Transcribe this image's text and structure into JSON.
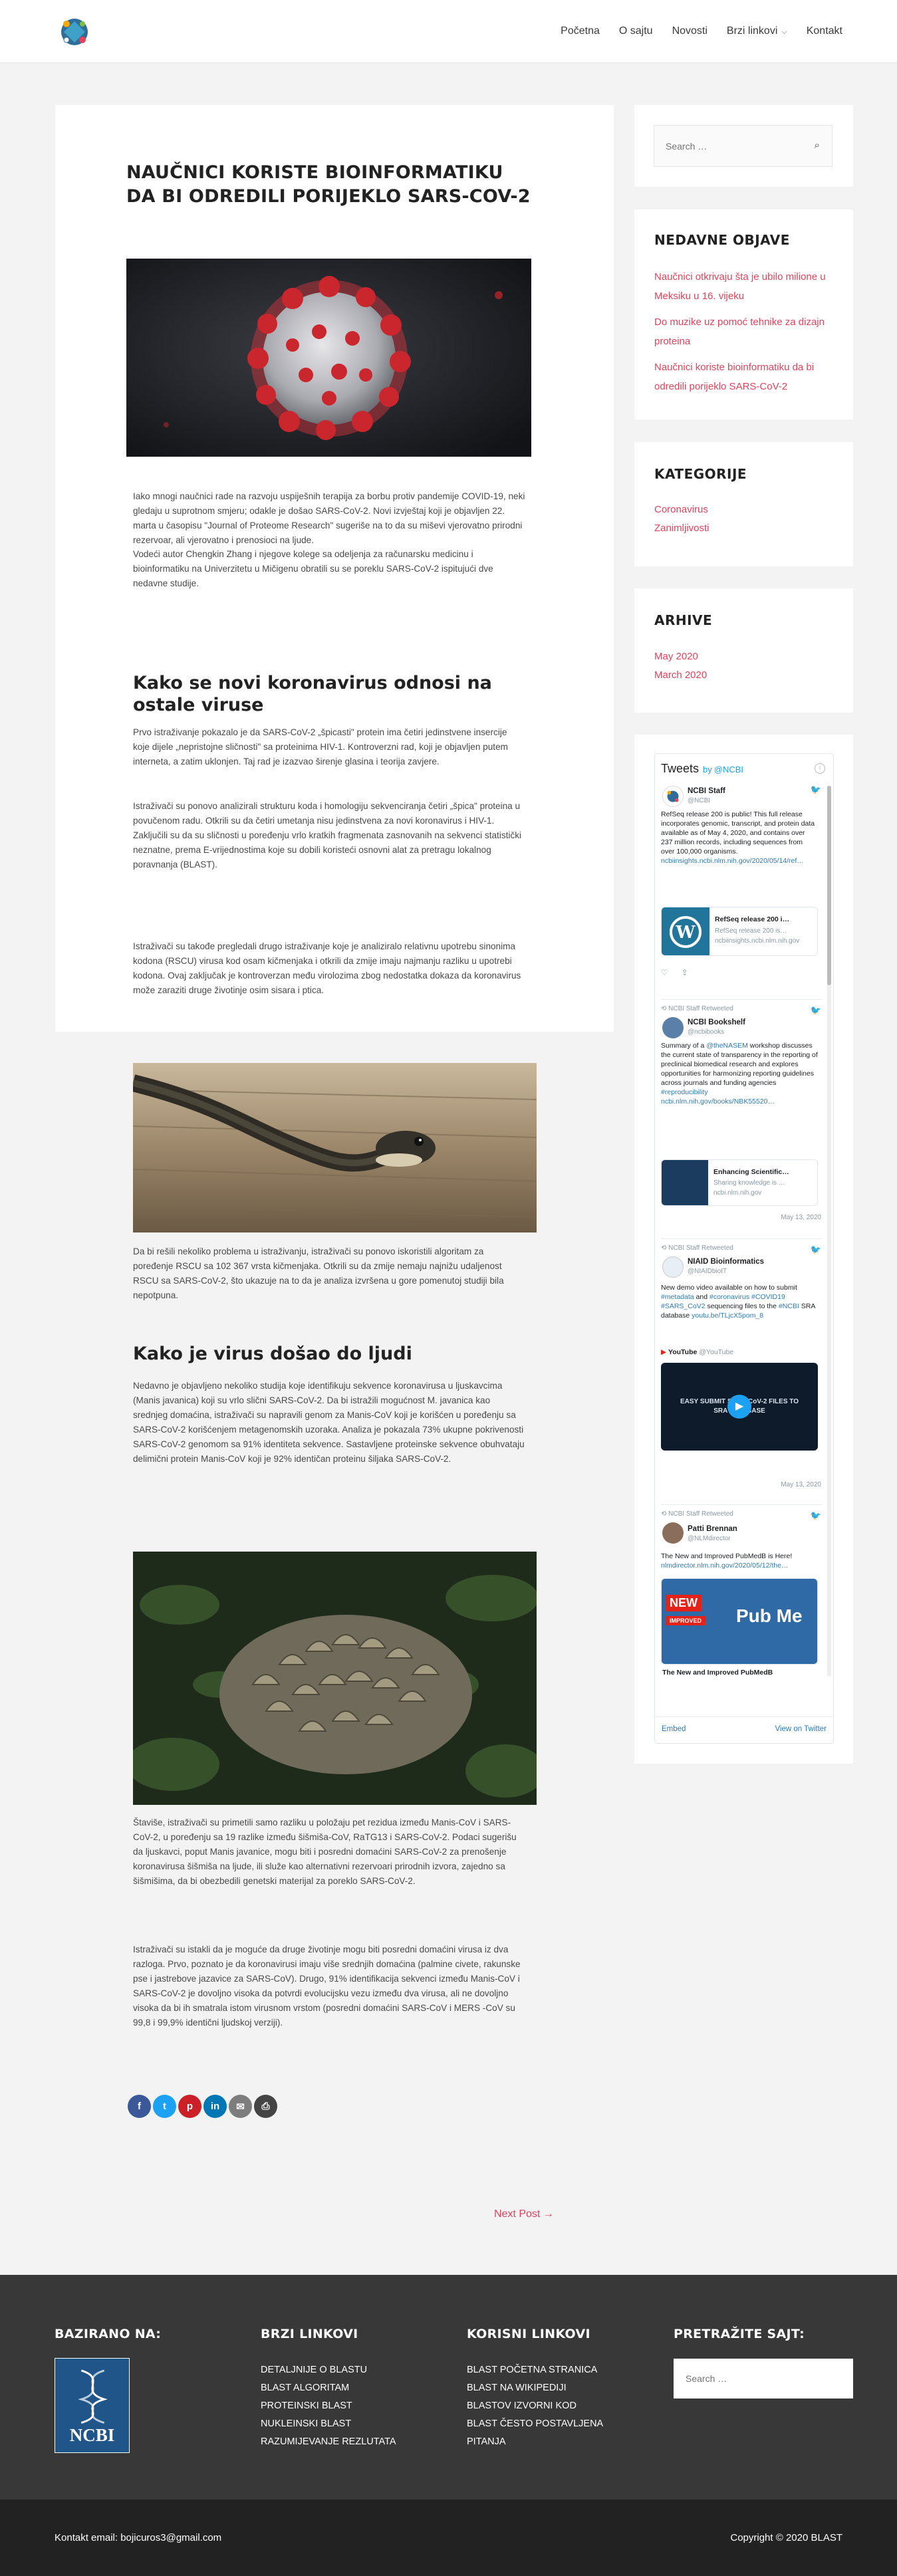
{
  "nav": {
    "items": [
      "Početna",
      "O sajtu",
      "Novosti",
      "Brzi linkovi",
      "Kontakt"
    ]
  },
  "article": {
    "title": "NAUČNICI KORISTE BIOINFORMATIKU DA BI ODREDILI PORIJEKLO SARS-COV-2",
    "p1": "Iako mnogi naučnici rade na razvoju uspiješnih terapija za borbu protiv pandemije COVID-19, neki gledaju u suprotnom smjeru; odakle je došao SARS-CoV-2. Novi izvještaj koji je objavljen 22. marta u časopisu \"Journal of Proteome Research\" sugeriše na to da su miševi vjerovatno prirodni rezervoar, ali vjerovatno i prenosioci na ljude.",
    "p2": "Vodeći autor Chengkin Zhang i njegove kolege sa odeljenja za računarsku medicinu i bioinformatiku na Univerzitetu u Mičigenu obratili su se poreklu SARS-CoV-2 ispitujući dve nedavne studije.",
    "h2a": "Kako se novi koronavirus odnosi na ostale viruse",
    "p3": "Prvo istraživanje pokazalo je da SARS-CoV-2 „špicasti\" protein ima četiri jedinstvene insercije koje dijele „nepristojne sličnosti\" sa proteinima HIV-1. Kontroverzni rad, koji je objavljen putem interneta, a zatim uklonjen. Taj rad je izazvao širenje glasina i teorija zavjere.",
    "p4": "Istraživači su ponovo analizirali strukturu koda i homologiju sekvenciranja četiri „špica\" proteina u povučenom radu. Otkrili su da četiri umetanja nisu jedinstvena za novi koronavirus i HIV-1. Zaključili su da su sličnosti u poređenju vrlo kratkih fragmenata zasnovanih na sekvenci statistički neznatne, prema E-vrijednostima koje su dobili koristeći osnovni alat za pretragu lokalnog poravnanja (BLAST).",
    "p5": "Istraživači su takođe pregledali drugo istraživanje koje je analiziralo relativnu upotrebu sinonima kodona (RSCU) virusa kod osam kičmenjaka i otkrili da zmije imaju najmanju razliku u upotrebi kodona. Ovaj zaključak je kontroverzan među virolozima zbog nedostatka dokaza da koronavirus može zaraziti druge životinje osim sisara i ptica.",
    "p6": "Da bi rešili nekoliko problema u istraživanju, istraživači su ponovo iskoristili algoritam za poređenje RSCU sa 102 367 vrsta kičmenjaka. Otkrili su da zmije nemaju najnižu udaljenost RSCU sa SARS-CoV-2, što ukazuje na to da je analiza izvršena u gore pomenutoj studiji bila nepotpuna.",
    "h2b": "Kako je virus došao do ljudi",
    "p7": "Nedavno je objavljeno nekoliko studija koje identifikuju sekvence koronavirusa u ljuskavcima (Manis javanica) koji su vrlo slični SARS-CoV-2. Da bi istražili mogućnost M. javanica kao srednjeg domaćina, istraživači su napravili genom za Manis-CoV koji je korišćen u poređenju sa SARS-CoV-2 korišćenjem metagenomskih uzoraka. Analiza je pokazala 73% ukupne pokrivenosti SARS-CoV-2 genomom sa 91% identiteta sekvence. Sastavljene proteinske sekvence obuhvataju delimični protein Manis-CoV koji je 92% identičan proteinu šiljaka SARS-CoV-2.",
    "p8": "Štaviše, istraživači su primetili samo razliku u položaju pet rezidua između Manis-CoV i SARS-CoV-2, u poređenju sa 19 razlike između šišmiša-CoV, RaTG13 i SARS-CoV-2. Podaci sugerišu da ljuskavci, poput Manis javanice, mogu biti i posredni domaćini SARS-CoV-2 za prenošenje koronavirusa šišmiša na ljude, ili služe kao alternativni rezervoari prirodnih izvora, zajedno sa šišmišima, da bi obezbedili genetski materijal za poreklo SARS-CoV-2.",
    "p9": "Istraživači su istakli da je moguće da druge životinje mogu biti posredni domaćini virusa iz dva razloga. Prvo, poznato je da koronavirusi imaju više srednjih domaćina (palmine civete, rakunske pse i jastrebove jazavice za SARS-CoV). Drugo, 91% identifikacija sekvenci između Manis-CoV i SARS-CoV-2 je dovoljno visoka da potvrdi evolucijsku vezu između dva virusa, ali ne dovoljno visoka da bi ih smatrala istom virusnom vrstom (posredni domaćini SARS-CoV i MERS -CoV su 99,8 i 99,9% identični ljudskoj verziji).",
    "share": [
      "f",
      "t",
      "p",
      "in",
      "✉",
      "⎙"
    ],
    "next_post": "Next Post →"
  },
  "sidebar": {
    "search_placeholder": "Search …",
    "recent_title": "NEDAVNE OBJAVE",
    "recent": [
      "Naučnici otkrivaju šta je ubilo milione u Meksiku u 16. vijeku",
      "Do muzike uz pomoć tehnike za dizajn proteina",
      "Naučnici koriste bioinformatiku da bi odredili porijeklo SARS-CoV-2"
    ],
    "categories_title": "KATEGORIJE",
    "categories": [
      "Coronavirus",
      "Zanimljivosti"
    ],
    "archive_title": "ARHIVE",
    "archive": [
      "May 2020",
      "March 2020"
    ]
  },
  "twitter": {
    "title": "Tweets",
    "by": "by",
    "handle": "@NCBI",
    "t1_name": "NCBI Staff",
    "t1_handle": "@NCBI",
    "t1_text": "RefSeq release 200 is public! This full release incorporates genomic, transcript, and protein data available as of May 4, 2020, and contains over 237 million records, including sequences from over 100,000 organisms.",
    "t1_link": "ncbiinsights.ncbi.nlm.nih.gov/2020/05/14/ref…",
    "t1_card_title": "RefSeq release 200 i…",
    "t1_card_sub1": "RefSeq release 200 is…",
    "t1_card_sub2": "ncbiinsights.ncbi.nlm.nih.gov",
    "t2_rt": "NCBI Staff Retweeted",
    "t2_name": "NCBI Bookshelf",
    "t2_handle": "@ncbibooks",
    "t2_text_pre": "Summary of a",
    "t2_mention": "@theNASEM",
    "t2_text": " workshop discusses the current state of transparency in the reporting of preclinical biomedical research and explores opportunities for harmonizing reporting guidelines across journals and funding agencies",
    "t2_hashtag": "#reproducibility",
    "t2_link": "ncbi.nlm.nih.gov/books/NBK55520…",
    "t2_card_title": "Enhancing Scientific…",
    "t2_card_sub1": "Sharing knowledge is …",
    "t2_card_sub2": "ncbi.nlm.nih.gov",
    "t2_date": "May 13, 2020",
    "t3_rt": "NCBI Staff Retweeted",
    "t3_name": "NIAID Bioinformatics",
    "t3_handle": "@NIAIDbioIT",
    "t3_text_a": "New demo video available on how to submit ",
    "t3_tag1": "#metadata",
    "t3_text_b": " and ",
    "t3_tag2": "#coronavirus #COVID19 #SARS_CoV2",
    "t3_text_c": " sequencing files to the ",
    "t3_tag3": "#NCBI",
    "t3_text_d": " SRA database",
    "t3_link": "youtu.be/TLjcX5pom_8",
    "t3_yt": "YouTube",
    "t3_yt_handle": "@YouTube",
    "t3_video": "EASY SUBMIT SARS-CoV-2 FILES TO SRA DATABASE",
    "t3_date": "May 13, 2020",
    "t4_rt": "NCBI Staff Retweeted",
    "t4_name": "Patti Brennan",
    "t4_handle": "@NLMdirector",
    "t4_text": "The New and Improved PubMedB is Here!",
    "t4_link": "nlmdirector.nlm.nih.gov/2020/05/12/the…",
    "t4_card_new": "NEW",
    "t4_card_improved": "IMPROVED",
    "t4_card_brand": "Pub Me",
    "t4_card_caption": "The New and Improved PubMedB",
    "embed": "Embed",
    "view": "View on Twitter"
  },
  "footer": {
    "col1_title": "BAZIRANO NA:",
    "ncbi_logo": "NCBI",
    "col2_title": "BRZI LINKOVI",
    "col2_links": [
      "DETALJNIJE O BLASTU",
      "BLAST ALGORITAM",
      "PROTEINSKI BLAST",
      "NUKLEINSKI BLAST",
      "RAZUMIJEVANJE REZLUTATA"
    ],
    "col3_title": "KORISNI LINKOVI",
    "col3_links": [
      "BLAST POČETNA STRANICA",
      "BLAST NA WIKIPEDIJI",
      "BLASTOV IZVORNI KOD",
      "BLAST ČESTO POSTAVLJENA",
      "PITANJA"
    ],
    "col4_title": "PRETRAŽITE SAJT:",
    "search_placeholder": "Search …",
    "contact": "Kontakt email: bojicuros3@gmail.com",
    "copyright": "Copyright © 2020 BLAST"
  },
  "colors": {
    "accent": "#e5425a",
    "twitter_blue": "#1da1f2",
    "footer_bg": "#383838",
    "bar_bg": "#222222"
  },
  "icons": [
    "logo-icon",
    "chevron-down-icon",
    "search-icon",
    "info-icon",
    "twitter-bird-icon",
    "heart-icon",
    "share-icon",
    "retweet-icon",
    "play-icon",
    "facebook-icon",
    "twitter-icon",
    "pinterest-icon",
    "linkedin-icon",
    "email-icon",
    "print-icon"
  ]
}
